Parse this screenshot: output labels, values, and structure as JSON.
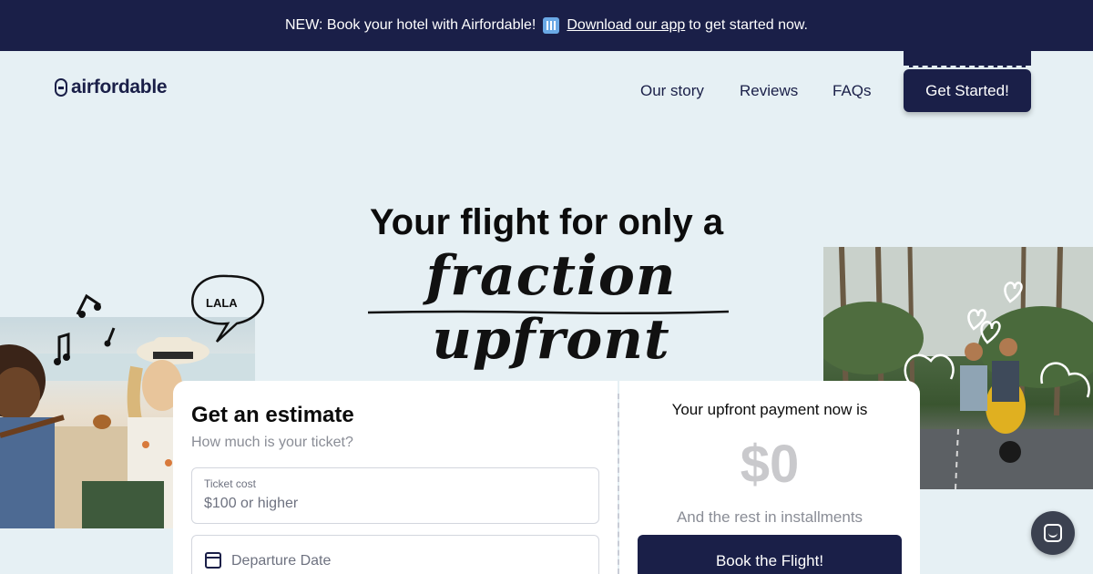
{
  "announcement": {
    "text_before": "NEW: Book your hotel with Airfordable!",
    "link_text": "Download our app",
    "text_after": "to get started now.",
    "emoji": "hotel-emoji"
  },
  "nav": {
    "brand": "airfordable",
    "links": [
      "Our story",
      "Reviews",
      "FAQs"
    ],
    "cta": "Get Started!"
  },
  "hero": {
    "title": "Your flight for only a",
    "script": "fraction upfront",
    "doodle_text": "LALA"
  },
  "estimate": {
    "title": "Get an estimate",
    "subtitle": "How much is your ticket?",
    "ticket_label": "Ticket cost",
    "ticket_placeholder": "$100 or higher",
    "date_placeholder": "Departure Date"
  },
  "payment": {
    "title": "Your upfront payment now is",
    "amount": "$0",
    "rest": "And the rest in installments",
    "button": "Book the Flight!"
  },
  "colors": {
    "navy": "#1a1f48",
    "background": "#e6f0f4",
    "card": "#ffffff"
  },
  "icons": {
    "chat": "chat-icon",
    "calendar": "calendar-icon"
  }
}
